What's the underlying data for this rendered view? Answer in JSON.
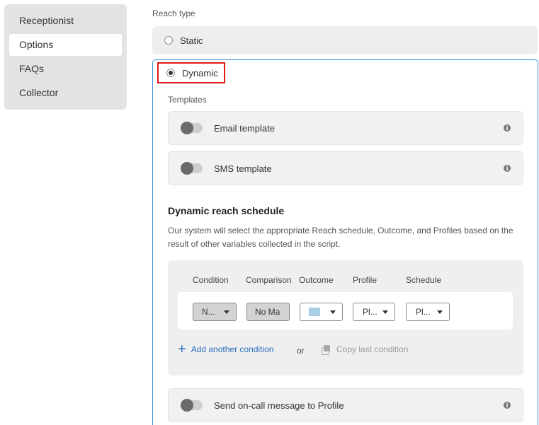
{
  "sidebar": {
    "items": [
      {
        "label": "Receptionist",
        "active": false
      },
      {
        "label": "Options",
        "active": true
      },
      {
        "label": "FAQs",
        "active": false
      },
      {
        "label": "Collector",
        "active": false
      }
    ]
  },
  "reach": {
    "label": "Reach type",
    "options": [
      {
        "label": "Static",
        "selected": false
      },
      {
        "label": "Dynamic",
        "selected": true
      }
    ]
  },
  "templates": {
    "label": "Templates",
    "items": [
      {
        "label": "Email template",
        "enabled": false
      },
      {
        "label": "SMS template",
        "enabled": false
      }
    ]
  },
  "schedule": {
    "title": "Dynamic reach schedule",
    "description": "Our system will select the appropriate Reach schedule, Outcome, and Profiles based on the result of other variables collected in the script.",
    "columns": [
      "Condition",
      "Comparison",
      "Outcome",
      "Profile",
      "Schedule"
    ],
    "row": {
      "condition": "N...",
      "comparison": "No Ma",
      "outcome_color": "#a9cde6",
      "profile": "Pl...",
      "schedule": "Pl..."
    },
    "add_label": "Add another condition",
    "or_label": "or",
    "copy_label": "Copy last condition"
  },
  "oncall": {
    "label": "Send on-call message to Profile",
    "enabled": false
  },
  "colors": {
    "accent": "#3a8fd8",
    "highlight": "#e01a1a",
    "link": "#2f6fbf"
  }
}
